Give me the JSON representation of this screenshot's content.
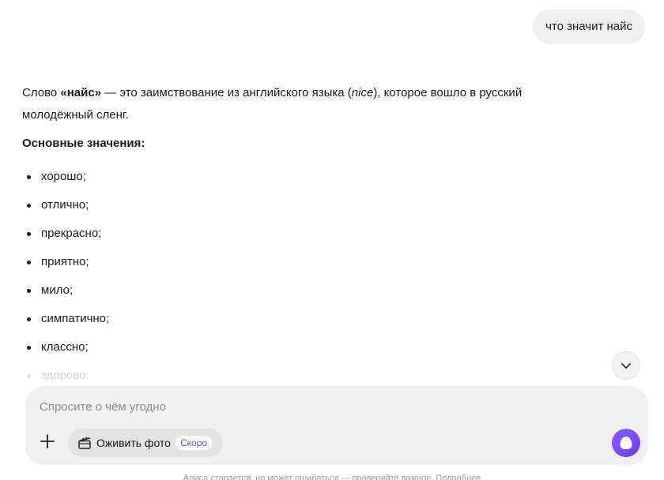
{
  "user_message": {
    "text": "что значит найс"
  },
  "answer": {
    "intro_before": "Слово ",
    "intro_term": "«найс»",
    "intro_middle": " — это заимствование из английского языка (",
    "intro_english": "nice",
    "intro_after": "), которое вошло в русский молодёжный сленг.",
    "subheading": "Основные значения:",
    "meanings": [
      "хорошо;",
      "отлично;",
      "прекрасно;",
      "приятно;",
      "мило;",
      "симпатично;",
      "классно;",
      "здорово."
    ]
  },
  "composer": {
    "placeholder": "Спросите о чём угодно",
    "photo_button_label": "Оживить фото",
    "soon_badge": "Скоро"
  },
  "footer": {
    "disclaimer": "Алиса старается, но может ошибаться — проверяйте важное. Подробнее"
  },
  "icons": {
    "scroll": "chevron-down-icon",
    "add": "plus-icon",
    "photo": "clapperboard-icon",
    "send": "alice-icon"
  },
  "colors": {
    "accent": "#7b4dff",
    "badge_text": "#6a4ce0",
    "panel": "#f0f0f0"
  }
}
